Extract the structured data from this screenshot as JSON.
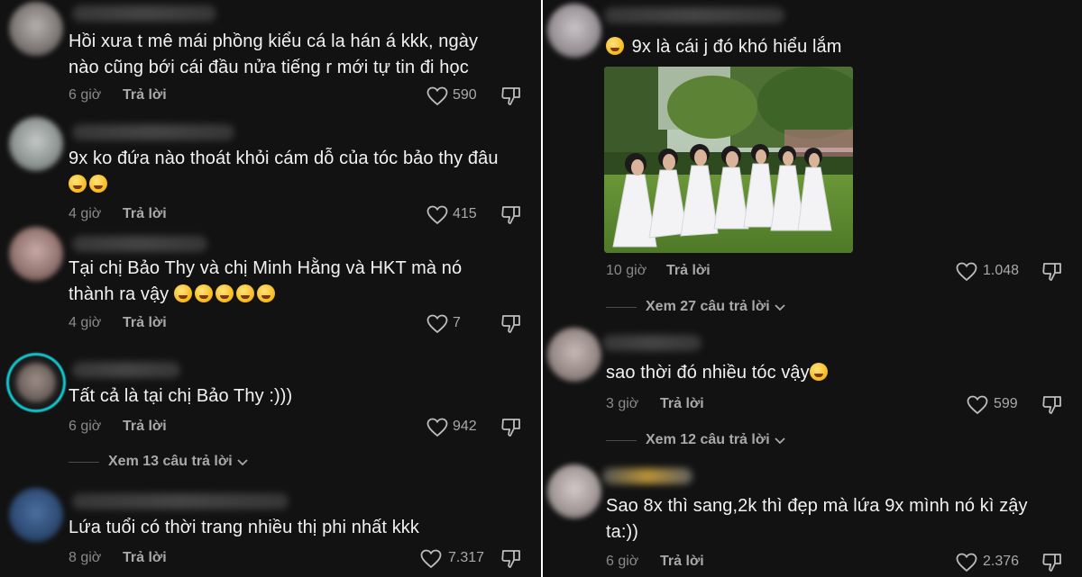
{
  "left": [
    {
      "text": "Hồi xưa t mê mái phồng kiểu cá la hán á kkk, ngày nào cũng bới cái đầu nửa tiếng r mới tự tin đi học",
      "time": "6 giờ",
      "reply": "Trả lời",
      "likes": "590",
      "emojis": 0
    },
    {
      "text": "9x ko đứa nào thoát khỏi cám dỗ của tóc bảo thy đâu",
      "time": "4 giờ",
      "reply": "Trả lời",
      "likes": "415",
      "emojis": 2
    },
    {
      "text": "Tại chị Bảo Thy và chị Minh Hằng và HKT mà nó thành ra vậy",
      "time": "4 giờ",
      "reply": "Trả lời",
      "likes": "7",
      "emojis": 5
    },
    {
      "text": "Tất cả là tại chị Bảo Thy :)))",
      "time": "6 giờ",
      "reply": "Trả lời",
      "likes": "942",
      "emojis": 0,
      "more": "Xem 13 câu trả lời"
    },
    {
      "text": "Lứa tuổi có thời trang nhiều thị phi nhất kkk",
      "time": "8 giờ",
      "reply": "Trả lời",
      "likes": "7.317",
      "emojis": 0
    }
  ],
  "right": [
    {
      "text": "9x là cái j đó khó hiểu lắm",
      "time": "10 giờ",
      "reply": "Trả lời",
      "likes": "1.048",
      "emojis": 1,
      "more": "Xem 27 câu trả lời"
    },
    {
      "text": "sao thời đó nhiều tóc vậy",
      "time": "3 giờ",
      "reply": "Trả lời",
      "likes": "599",
      "emojis": 1,
      "more": "Xem 12 câu trả lời"
    },
    {
      "text": "Sao 8x thì sang,2k thì đẹp mà lứa 9x mình nó kì zậy ta:))",
      "time": "6 giờ",
      "reply": "Trả lời",
      "likes": "2.376",
      "emojis": 0
    }
  ],
  "icons": {
    "like": "heart-outline-icon",
    "dislike": "thumbs-down-outline-icon",
    "chevron": "chevron-down-icon"
  },
  "colors": {
    "background": "#121212",
    "story_ring": "#12c6cf",
    "muted": "#8a8a8a"
  }
}
